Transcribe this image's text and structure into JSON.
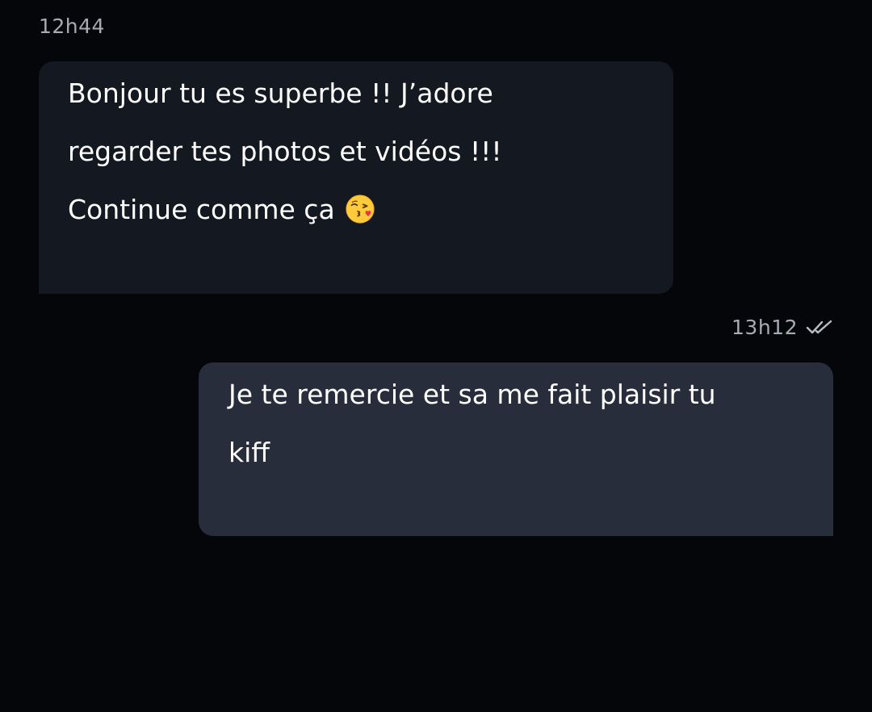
{
  "messages": [
    {
      "direction": "incoming",
      "time": "12h44",
      "lines": [
        "Bonjour tu es superbe !! J’adore",
        "regarder tes photos et vidéos !!!",
        "Continue comme ça"
      ],
      "emoji": "face-blowing-a-kiss-icon"
    },
    {
      "direction": "outgoing",
      "time": "13h12",
      "status_icon": "double-check-icon",
      "lines": [
        "Je te remercie et sa me fait plaisir tu",
        "kiff"
      ]
    }
  ],
  "colors": {
    "background": "#05060a",
    "incoming_bubble": "#141820",
    "outgoing_bubble": "#272d3a",
    "timestamp": "#a7abb3",
    "text": "#ffffff"
  }
}
